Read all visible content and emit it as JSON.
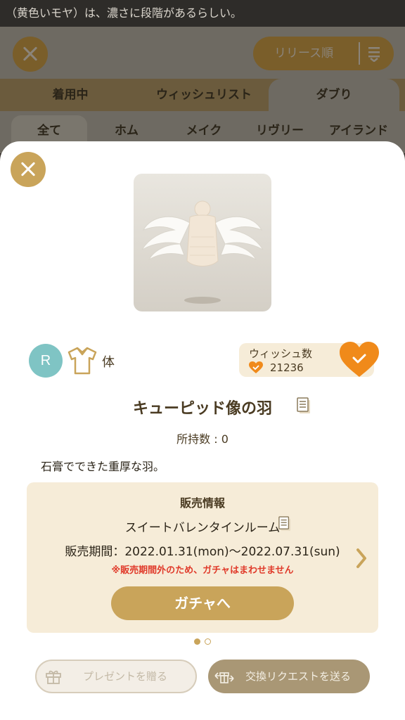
{
  "background": {
    "hint_text": "（黄色いモヤ）は、濃さに段階があるらしい。",
    "sort_label": "リリース順",
    "tabs": [
      {
        "label": "着用中",
        "active": false
      },
      {
        "label": "ウィッシュリスト",
        "active": false
      },
      {
        "label": "ダブり",
        "active": true
      }
    ],
    "categories": [
      {
        "label": "全て",
        "active": true
      },
      {
        "label": "ホム",
        "active": false
      },
      {
        "label": "メイク",
        "active": false
      },
      {
        "label": "リヴリー",
        "active": false
      },
      {
        "label": "アイランド",
        "active": false
      }
    ]
  },
  "item": {
    "rarity": "R",
    "category_icon": "shirt-icon",
    "category_label": "体",
    "name": "キューピッド像の羽",
    "owned_text": "所持数 : 0",
    "description": "石膏でできた重厚な羽。",
    "image_icon": "cupid-wings-statue-item"
  },
  "wish": {
    "title": "ウィッシュ数",
    "count": "21236",
    "wished": true
  },
  "sale": {
    "title": "販売情報",
    "gacha_name": "スイートバレンタインルーム",
    "period": "販売期間：2022.01.31(mon)〜2022.07.31(sun)",
    "warning": "※販売期間外のため、ガチャはまわせません",
    "gacha_button": "ガチャへ"
  },
  "pagination": {
    "current": 1,
    "total": 2
  },
  "actions": {
    "present_label": "プレゼントを贈る",
    "present_enabled": false,
    "trade_label": "交換リクエストを送る",
    "trade_enabled": false
  },
  "colors": {
    "accent_gold": "#c9a45a",
    "wish_orange": "#f08a1a",
    "rarity_teal": "#7fc4c4",
    "warning_red": "#e03a2a",
    "panel_beige": "#f6ecd8"
  }
}
